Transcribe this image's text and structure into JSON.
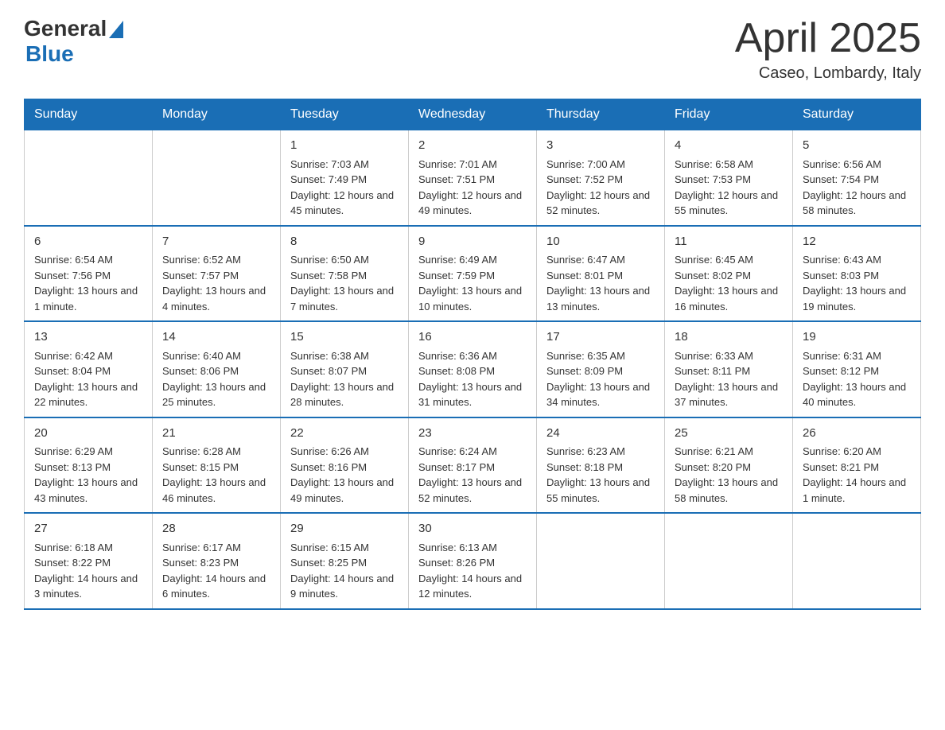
{
  "header": {
    "logo_general": "General",
    "logo_blue": "Blue",
    "month": "April 2025",
    "location": "Caseo, Lombardy, Italy"
  },
  "days_of_week": [
    "Sunday",
    "Monday",
    "Tuesday",
    "Wednesday",
    "Thursday",
    "Friday",
    "Saturday"
  ],
  "weeks": [
    [
      {
        "num": "",
        "sunrise": "",
        "sunset": "",
        "daylight": ""
      },
      {
        "num": "",
        "sunrise": "",
        "sunset": "",
        "daylight": ""
      },
      {
        "num": "1",
        "sunrise": "Sunrise: 7:03 AM",
        "sunset": "Sunset: 7:49 PM",
        "daylight": "Daylight: 12 hours and 45 minutes."
      },
      {
        "num": "2",
        "sunrise": "Sunrise: 7:01 AM",
        "sunset": "Sunset: 7:51 PM",
        "daylight": "Daylight: 12 hours and 49 minutes."
      },
      {
        "num": "3",
        "sunrise": "Sunrise: 7:00 AM",
        "sunset": "Sunset: 7:52 PM",
        "daylight": "Daylight: 12 hours and 52 minutes."
      },
      {
        "num": "4",
        "sunrise": "Sunrise: 6:58 AM",
        "sunset": "Sunset: 7:53 PM",
        "daylight": "Daylight: 12 hours and 55 minutes."
      },
      {
        "num": "5",
        "sunrise": "Sunrise: 6:56 AM",
        "sunset": "Sunset: 7:54 PM",
        "daylight": "Daylight: 12 hours and 58 minutes."
      }
    ],
    [
      {
        "num": "6",
        "sunrise": "Sunrise: 6:54 AM",
        "sunset": "Sunset: 7:56 PM",
        "daylight": "Daylight: 13 hours and 1 minute."
      },
      {
        "num": "7",
        "sunrise": "Sunrise: 6:52 AM",
        "sunset": "Sunset: 7:57 PM",
        "daylight": "Daylight: 13 hours and 4 minutes."
      },
      {
        "num": "8",
        "sunrise": "Sunrise: 6:50 AM",
        "sunset": "Sunset: 7:58 PM",
        "daylight": "Daylight: 13 hours and 7 minutes."
      },
      {
        "num": "9",
        "sunrise": "Sunrise: 6:49 AM",
        "sunset": "Sunset: 7:59 PM",
        "daylight": "Daylight: 13 hours and 10 minutes."
      },
      {
        "num": "10",
        "sunrise": "Sunrise: 6:47 AM",
        "sunset": "Sunset: 8:01 PM",
        "daylight": "Daylight: 13 hours and 13 minutes."
      },
      {
        "num": "11",
        "sunrise": "Sunrise: 6:45 AM",
        "sunset": "Sunset: 8:02 PM",
        "daylight": "Daylight: 13 hours and 16 minutes."
      },
      {
        "num": "12",
        "sunrise": "Sunrise: 6:43 AM",
        "sunset": "Sunset: 8:03 PM",
        "daylight": "Daylight: 13 hours and 19 minutes."
      }
    ],
    [
      {
        "num": "13",
        "sunrise": "Sunrise: 6:42 AM",
        "sunset": "Sunset: 8:04 PM",
        "daylight": "Daylight: 13 hours and 22 minutes."
      },
      {
        "num": "14",
        "sunrise": "Sunrise: 6:40 AM",
        "sunset": "Sunset: 8:06 PM",
        "daylight": "Daylight: 13 hours and 25 minutes."
      },
      {
        "num": "15",
        "sunrise": "Sunrise: 6:38 AM",
        "sunset": "Sunset: 8:07 PM",
        "daylight": "Daylight: 13 hours and 28 minutes."
      },
      {
        "num": "16",
        "sunrise": "Sunrise: 6:36 AM",
        "sunset": "Sunset: 8:08 PM",
        "daylight": "Daylight: 13 hours and 31 minutes."
      },
      {
        "num": "17",
        "sunrise": "Sunrise: 6:35 AM",
        "sunset": "Sunset: 8:09 PM",
        "daylight": "Daylight: 13 hours and 34 minutes."
      },
      {
        "num": "18",
        "sunrise": "Sunrise: 6:33 AM",
        "sunset": "Sunset: 8:11 PM",
        "daylight": "Daylight: 13 hours and 37 minutes."
      },
      {
        "num": "19",
        "sunrise": "Sunrise: 6:31 AM",
        "sunset": "Sunset: 8:12 PM",
        "daylight": "Daylight: 13 hours and 40 minutes."
      }
    ],
    [
      {
        "num": "20",
        "sunrise": "Sunrise: 6:29 AM",
        "sunset": "Sunset: 8:13 PM",
        "daylight": "Daylight: 13 hours and 43 minutes."
      },
      {
        "num": "21",
        "sunrise": "Sunrise: 6:28 AM",
        "sunset": "Sunset: 8:15 PM",
        "daylight": "Daylight: 13 hours and 46 minutes."
      },
      {
        "num": "22",
        "sunrise": "Sunrise: 6:26 AM",
        "sunset": "Sunset: 8:16 PM",
        "daylight": "Daylight: 13 hours and 49 minutes."
      },
      {
        "num": "23",
        "sunrise": "Sunrise: 6:24 AM",
        "sunset": "Sunset: 8:17 PM",
        "daylight": "Daylight: 13 hours and 52 minutes."
      },
      {
        "num": "24",
        "sunrise": "Sunrise: 6:23 AM",
        "sunset": "Sunset: 8:18 PM",
        "daylight": "Daylight: 13 hours and 55 minutes."
      },
      {
        "num": "25",
        "sunrise": "Sunrise: 6:21 AM",
        "sunset": "Sunset: 8:20 PM",
        "daylight": "Daylight: 13 hours and 58 minutes."
      },
      {
        "num": "26",
        "sunrise": "Sunrise: 6:20 AM",
        "sunset": "Sunset: 8:21 PM",
        "daylight": "Daylight: 14 hours and 1 minute."
      }
    ],
    [
      {
        "num": "27",
        "sunrise": "Sunrise: 6:18 AM",
        "sunset": "Sunset: 8:22 PM",
        "daylight": "Daylight: 14 hours and 3 minutes."
      },
      {
        "num": "28",
        "sunrise": "Sunrise: 6:17 AM",
        "sunset": "Sunset: 8:23 PM",
        "daylight": "Daylight: 14 hours and 6 minutes."
      },
      {
        "num": "29",
        "sunrise": "Sunrise: 6:15 AM",
        "sunset": "Sunset: 8:25 PM",
        "daylight": "Daylight: 14 hours and 9 minutes."
      },
      {
        "num": "30",
        "sunrise": "Sunrise: 6:13 AM",
        "sunset": "Sunset: 8:26 PM",
        "daylight": "Daylight: 14 hours and 12 minutes."
      },
      {
        "num": "",
        "sunrise": "",
        "sunset": "",
        "daylight": ""
      },
      {
        "num": "",
        "sunrise": "",
        "sunset": "",
        "daylight": ""
      },
      {
        "num": "",
        "sunrise": "",
        "sunset": "",
        "daylight": ""
      }
    ]
  ]
}
